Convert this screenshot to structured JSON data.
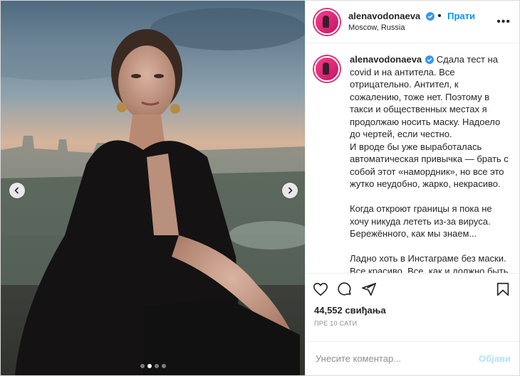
{
  "header": {
    "username": "alenavodonaeva",
    "follow_label": "Прати",
    "location": "Moscow, Russia",
    "more_label": "•••"
  },
  "caption": {
    "username": "alenavodonaeva",
    "text": "Сдала тест на covid и на антитела. Все отрицательно. Антител, к сожалению, тоже нет. Поэтому в такси и общественных местах я продолжаю носить маску. Надоело до чертей, если честно.\nИ вроде бы уже выработалась автоматическая привычка — брать с собой этот «намордник», но все это жутко неудобно, жарко, некрасиво.\n\nКогда откроют границы я пока не хочу никуда лететь из-за вируса. Бережённого, как мы знаем...\n\nЛадно хоть в Инстаграме без маски. Все красиво. Все, как и должно быть в Инстаграме ) Носите маску на улице? По-честному?"
  },
  "likes": "44,552 свиђања",
  "time": "ПРЕ 10 САТИ",
  "comment_input": {
    "placeholder": "Унесите коментар...",
    "value": ""
  },
  "post_label": "Објави",
  "carousel": {
    "count": 4,
    "active_index": 1
  },
  "icons": [
    "like-icon",
    "comment-icon",
    "share-icon",
    "save-icon",
    "verified-icon",
    "chevron-left-icon",
    "chevron-right-icon"
  ],
  "colors": {
    "accent": "#0095f6",
    "post_disabled": "#b2dffc",
    "story_ring": "#e1306c"
  }
}
